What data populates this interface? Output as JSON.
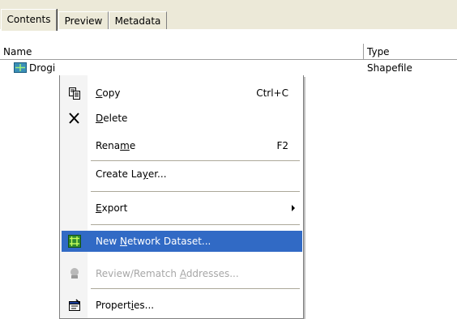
{
  "tabs": [
    {
      "label": "Contents"
    },
    {
      "label": "Preview"
    },
    {
      "label": "Metadata"
    }
  ],
  "columns": {
    "name": "Name",
    "type": "Type"
  },
  "rows": [
    {
      "name": "Drogi",
      "type": "Shapefile",
      "icon": "line-shapefile-icon"
    }
  ],
  "context_menu": {
    "copy": {
      "pre": "",
      "key": "C",
      "post": "opy",
      "shortcut": "Ctrl+C"
    },
    "delete": {
      "pre": "",
      "key": "D",
      "post": "elete"
    },
    "rename": {
      "pre": "Rena",
      "key": "m",
      "post": "e",
      "shortcut": "F2"
    },
    "create": {
      "pre": "Create La",
      "key": "y",
      "post": "er..."
    },
    "export": {
      "pre": "",
      "key": "E",
      "post": "xport"
    },
    "network": {
      "pre": "New ",
      "key": "N",
      "post": "etwork Dataset..."
    },
    "review": {
      "pre": "Review/Rematch ",
      "key": "A",
      "post": "ddresses..."
    },
    "props": {
      "pre": "Propert",
      "key": "i",
      "post": "es..."
    }
  },
  "colors": {
    "highlight": "#316ac5",
    "disabled_text": "#a7a7a7",
    "tab_bg": "#ece9d8"
  }
}
